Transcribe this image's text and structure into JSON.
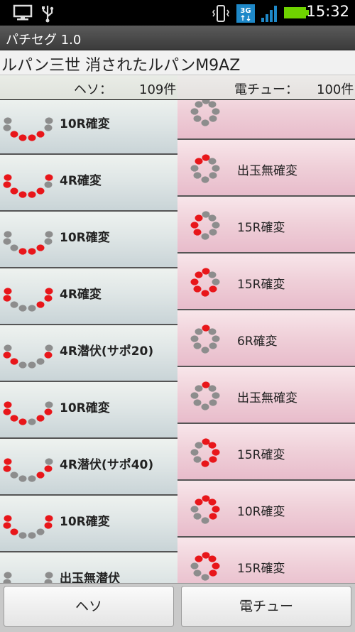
{
  "status_bar": {
    "time": "15:32",
    "network_label": "3G",
    "icons": [
      "monitor-icon",
      "usb-icon",
      "vibrate-icon",
      "3g-icon",
      "signal-icon",
      "battery-icon"
    ]
  },
  "app": {
    "title": "パチセグ 1.0"
  },
  "machine_name": "ルパン三世 消されたルパンM9AZ",
  "counts": {
    "heso": {
      "label": "ヘソ：",
      "value": "109件"
    },
    "denchu": {
      "label": "電チュー：",
      "value": "100件"
    }
  },
  "heso_list": [
    {
      "label": "10R確変",
      "pattern": [
        0,
        0,
        1,
        1,
        1,
        1,
        0,
        0
      ]
    },
    {
      "label": "4R確変",
      "pattern": [
        1,
        1,
        1,
        1,
        1,
        1,
        0,
        1
      ]
    },
    {
      "label": "10R確変",
      "pattern": [
        0,
        0,
        0,
        1,
        1,
        1,
        0,
        0
      ]
    },
    {
      "label": "4R確変",
      "pattern": [
        1,
        1,
        0,
        0,
        0,
        1,
        1,
        1
      ]
    },
    {
      "label": "4R潜伏(サポ20)",
      "pattern": [
        0,
        1,
        1,
        0,
        0,
        0,
        1,
        0
      ]
    },
    {
      "label": "10R確変",
      "pattern": [
        1,
        1,
        1,
        1,
        0,
        1,
        1,
        0
      ]
    },
    {
      "label": "4R潜伏(サポ40)",
      "pattern": [
        1,
        1,
        0,
        0,
        0,
        1,
        1,
        0
      ]
    },
    {
      "label": "10R確変",
      "pattern": [
        1,
        1,
        1,
        0,
        0,
        0,
        1,
        1
      ]
    },
    {
      "label": "出玉無潜伏",
      "pattern": [
        0,
        0,
        0,
        0,
        0,
        0,
        0,
        0
      ]
    }
  ],
  "denchu_list": [
    {
      "label": "",
      "pattern": [
        0,
        0,
        0,
        0,
        0,
        0,
        0,
        0
      ]
    },
    {
      "label": "出玉無確変",
      "pattern": [
        1,
        1,
        0,
        0,
        0,
        0,
        0,
        0
      ]
    },
    {
      "label": "15R確変",
      "pattern": [
        0,
        1,
        1,
        1,
        0,
        0,
        0,
        0
      ]
    },
    {
      "label": "15R確変",
      "pattern": [
        1,
        1,
        1,
        1,
        1,
        1,
        0,
        0
      ]
    },
    {
      "label": "6R確変",
      "pattern": [
        1,
        0,
        0,
        0,
        0,
        0,
        0,
        0
      ]
    },
    {
      "label": "出玉無確変",
      "pattern": [
        1,
        0,
        0,
        0,
        0,
        0,
        0,
        0
      ]
    },
    {
      "label": "15R確変",
      "pattern": [
        1,
        0,
        0,
        0,
        1,
        1,
        1,
        1
      ]
    },
    {
      "label": "10R確変",
      "pattern": [
        1,
        1,
        0,
        0,
        0,
        1,
        1,
        1
      ]
    },
    {
      "label": "15R確変",
      "pattern": [
        1,
        1,
        0,
        0,
        0,
        1,
        1,
        1
      ]
    }
  ],
  "buttons": {
    "heso": "ヘソ",
    "denchu": "電チュー"
  },
  "colors": {
    "lamp_on": "#e8161a",
    "lamp_off": "#8d8d8d"
  }
}
